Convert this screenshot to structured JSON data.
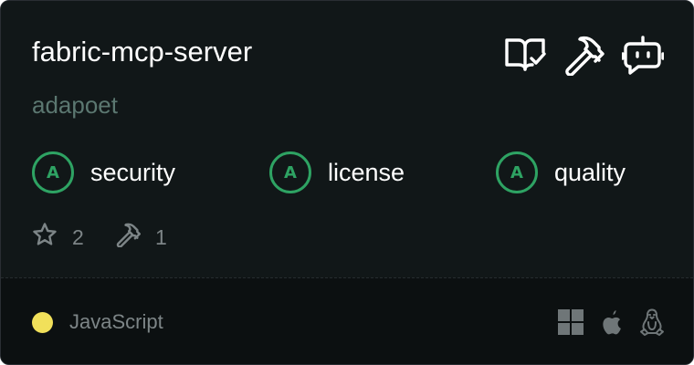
{
  "colors": {
    "card_bg": "#111718",
    "footer_bg": "#0c1011",
    "title": "#ffffff",
    "owner": "#5b7770",
    "grade_green": "#2ea363",
    "muted": "#7d8587",
    "language_dot": "#f1e05a"
  },
  "repo": {
    "name": "fabric-mcp-server",
    "owner": "adapoet"
  },
  "header_icons": [
    "docs-check-icon",
    "hammer-icon",
    "bot-icon"
  ],
  "scores": [
    {
      "grade": "A",
      "label": "security"
    },
    {
      "grade": "A",
      "label": "license"
    },
    {
      "grade": "A",
      "label": "quality"
    }
  ],
  "stats": {
    "stars": "2",
    "tools": "1"
  },
  "language": {
    "name": "JavaScript"
  },
  "platforms": [
    "windows-icon",
    "apple-icon",
    "linux-icon"
  ]
}
